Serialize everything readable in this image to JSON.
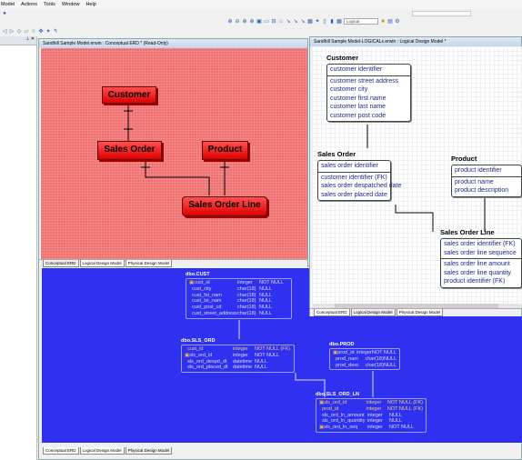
{
  "menu": [
    "Model",
    "Actions",
    "Tools",
    "Window",
    "Help"
  ],
  "toolbar": {
    "view_select": "Logical"
  },
  "windows": {
    "conceptual": {
      "title": "Sandhill Sample Model.erwin : Conceptual ERD * (Read-Only)",
      "entities": [
        "Customer",
        "Sales Order",
        "Product",
        "Sales Order Line"
      ]
    },
    "logical": {
      "title": "Sandhill Sample Model-LOGICALx.erwin : Logical Design Model *",
      "entities": [
        {
          "name": "Customer",
          "keys": [
            "customer identifier"
          ],
          "attrs": [
            "customer street address",
            "customer city",
            "customer first name",
            "customer last name",
            "customer post code"
          ]
        },
        {
          "name": "Sales Order",
          "keys": [
            "sales order identifier"
          ],
          "attrs": [
            "customer identifier (FK)",
            "sales order despatched date",
            "sales order placed date"
          ]
        },
        {
          "name": "Product",
          "keys": [
            "product identifier"
          ],
          "attrs": [
            "product name",
            "product description"
          ]
        },
        {
          "name": "Sales Order Line",
          "keys": [
            "sales order identifier (FK)",
            "sales order line sequence"
          ],
          "attrs": [
            "sales order line amount",
            "sales order line quantity",
            "product identifier (FK)"
          ]
        }
      ]
    },
    "physical": {
      "tables": [
        {
          "name": "dbo.CUST",
          "rows": [
            [
              "cust_id",
              "integer",
              "NOT NULL"
            ],
            [
              "cust_city",
              "char(18)",
              "NULL"
            ],
            [
              "cust_fst_nam",
              "char(18)",
              "NULL"
            ],
            [
              "cust_lst_nam",
              "char(18)",
              "NULL"
            ],
            [
              "cust_post_cd",
              "char(18)",
              "NULL"
            ],
            [
              "cust_street_address",
              "char(18)",
              "NULL"
            ]
          ]
        },
        {
          "name": "dbo.SLS_ORD",
          "rows": [
            [
              "cust_id",
              "integer",
              "NOT NULL (FK)"
            ],
            [
              "sls_ord_id",
              "integer",
              "NOT NULL"
            ],
            [
              "sls_ord_despd_dt",
              "datetime",
              "NULL"
            ],
            [
              "sls_ord_placed_dt",
              "datetime",
              "NULL"
            ]
          ]
        },
        {
          "name": "dbo.PROD",
          "rows": [
            [
              "prod_id",
              "integer",
              "NOT NULL"
            ],
            [
              "prod_nam",
              "char(18)",
              "NULL"
            ],
            [
              "prod_desc",
              "char(18)",
              "NULL"
            ]
          ]
        },
        {
          "name": "dbo.SLS_ORD_LN",
          "rows": [
            [
              "sls_ord_id",
              "integer",
              "NOT NULL (FK)"
            ],
            [
              "prod_id",
              "integer",
              "NOT NULL (FK)"
            ],
            [
              "sls_ord_ln_amount",
              "integer",
              "NULL"
            ],
            [
              "sls_ord_ln_quantity",
              "integer",
              "NULL"
            ],
            [
              "sls_ord_ln_seq",
              "integer",
              "NOT NULL"
            ]
          ]
        }
      ]
    }
  },
  "tabs": [
    "Conceptual ERD",
    "Logical Design Model",
    "Physical Design Model"
  ],
  "colors": {
    "conceptual_bg": "#f07070",
    "physical_bg": "#3030f0",
    "entity_red": "#e00000"
  }
}
